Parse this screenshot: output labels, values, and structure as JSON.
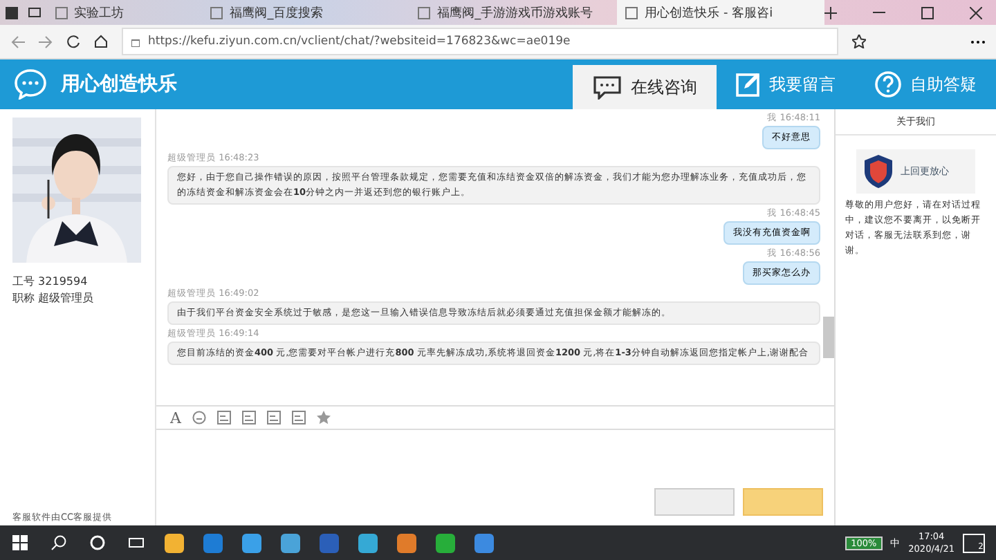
{
  "browser": {
    "tabs": [
      {
        "title": "实验工坊",
        "selected": false
      },
      {
        "title": "福鹰阀_百度搜索",
        "selected": false
      },
      {
        "title": "福鹰阀_手游游戏币游戏账号",
        "selected": false
      },
      {
        "title": "用心创造快乐 - 客服咨i",
        "selected": true
      }
    ],
    "address": "https://kefu.ziyun.com.cn/vclient/chat/?websiteid=176823&wc=ae019e"
  },
  "header": {
    "title": "用心创造快乐",
    "nav": [
      {
        "label": "在线咨询",
        "selected": true
      },
      {
        "label": "我要留言",
        "selected": false
      },
      {
        "label": "自助答疑",
        "selected": false
      }
    ]
  },
  "toolbar": {
    "font_button": "A"
  },
  "agent": {
    "id_label": "工号",
    "id": "3219594",
    "title_label": "职称",
    "title": "超级管理员",
    "footer": "客服软件由CC客服提供"
  },
  "messages": [
    {
      "kind": "me",
      "sender": "我",
      "time": "16:48:11",
      "text": "不好意思"
    },
    {
      "kind": "agent",
      "sender": "超级管理员",
      "time": "16:48:23",
      "text": "您好，由于您自己操作错误的原因，按照平台管理条款规定，您需要充值和冻结资金双倍的解冻资金，我们才能为您办理解冻业务，充值成功后，您的冻结资金和解冻资金会在**10**分钟之内一并返还到您的银行账户上。"
    },
    {
      "kind": "me",
      "sender": "我",
      "time": "16:48:45",
      "text": "我没有充值资金啊"
    },
    {
      "kind": "me",
      "sender": "我",
      "time": "16:48:56",
      "text": "那买家怎么办"
    },
    {
      "kind": "agent",
      "sender": "超级管理员",
      "time": "16:49:02",
      "text": "由于我们平台资金安全系统过于敏感，是您这一旦输入错误信息导致冻结后就必须要通过充值担保金额才能解冻的。"
    },
    {
      "kind": "agent",
      "sender": "超级管理员",
      "time": "16:49:14",
      "text": "您目前冻结的资金**400** 元,您需要对平台帐户进行充**800** 元率先解冻成功,系统将退回资金**1200** 元,将在**1-3**分钟自动解冻返回您指定帐户上,谢谢配合"
    }
  ],
  "about": {
    "title": "关于我们",
    "logo_text": "上回更放心",
    "notice": "尊敬的用户您好，请在对话过程中，建议您不要离开，以免断开对话，客服无法联系到您，谢谢。"
  },
  "taskbar": {
    "battery": "100%",
    "ime": "中",
    "time": "17:04",
    "date": "2020/4/21",
    "notifications": "2"
  }
}
